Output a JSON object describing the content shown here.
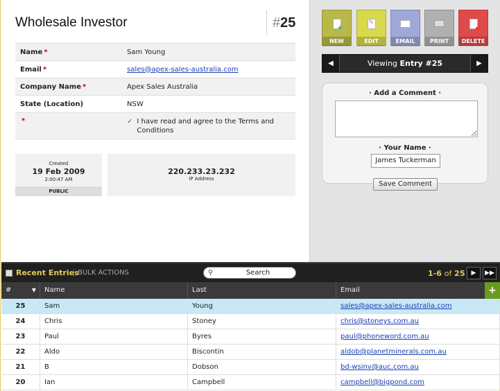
{
  "form": {
    "title": "Wholesale Investor",
    "entry_hash": "#",
    "entry_number": "25"
  },
  "fields": [
    {
      "label": "Name",
      "required": "*",
      "value": "Sam Young"
    },
    {
      "label": "Email",
      "required": "*",
      "value": "sales@apex-sales-australia.com"
    },
    {
      "label": "Company Name",
      "required": "*",
      "value": "Apex Sales Australia"
    },
    {
      "label": "State (Location)",
      "required": "",
      "value": "NSW"
    },
    {
      "label": "",
      "required": "*",
      "check": "✓",
      "value": "I have read and agree to the Terms and Conditions"
    }
  ],
  "meta": {
    "created_label": "Created",
    "created_date": "19 Feb 2009",
    "created_time": "2:00:47 AM",
    "visibility": "PUBLIC",
    "ip": "220.233.23.232",
    "ip_label": "IP Address"
  },
  "actions": {
    "new": "NEW",
    "edit": "EDIT",
    "email": "EMAIL",
    "print": "PRINT",
    "delete": "DELETE"
  },
  "nav": {
    "prev": "◀",
    "next": "▶",
    "viewing": "Viewing",
    "entry_label": "Entry #25"
  },
  "comment": {
    "title": "· Add a Comment ·",
    "name_title": "· Your Name ·",
    "name_value": "James Tuckerman",
    "save_label": "Save Comment"
  },
  "toolbar": {
    "recent_label": "Recent Entries",
    "bulk_label": "BULK ACTIONS",
    "search_placeholder": "Search",
    "page_range": "1-6",
    "page_of": "of",
    "page_total": "25",
    "next": "▶",
    "last": "▶▶"
  },
  "grid": {
    "columns": [
      "#",
      "Name",
      "Last",
      "Email"
    ],
    "add": "+",
    "rows": [
      {
        "num": "25",
        "name": "Sam",
        "last": "Young",
        "email": "sales@apex-sales-australia.com"
      },
      {
        "num": "24",
        "name": "Chris",
        "last": "Stoney",
        "email": "chris@stoneys.com.au"
      },
      {
        "num": "23",
        "name": "Paul",
        "last": "Byres",
        "email": "paul@phoneword.com.au"
      },
      {
        "num": "22",
        "name": "Aldo",
        "last": "Biscontin",
        "email": "aldob@planetminerals.com.au"
      },
      {
        "num": "21",
        "name": "B",
        "last": "Dobson",
        "email": "bd-wsinv@auc.com.au"
      },
      {
        "num": "20",
        "name": "Ian",
        "last": "Campbell",
        "email": "campbell@bigpond.com"
      }
    ]
  },
  "colors": {
    "accent_gold": "#e6c95a",
    "new": "#b9b94a",
    "edit": "#d9d94e",
    "email": "#9fa8d8",
    "print": "#b0b0b0",
    "delete": "#e04a4a",
    "selected_row": "#c8e8f6",
    "add_green": "#6a9b1e"
  }
}
